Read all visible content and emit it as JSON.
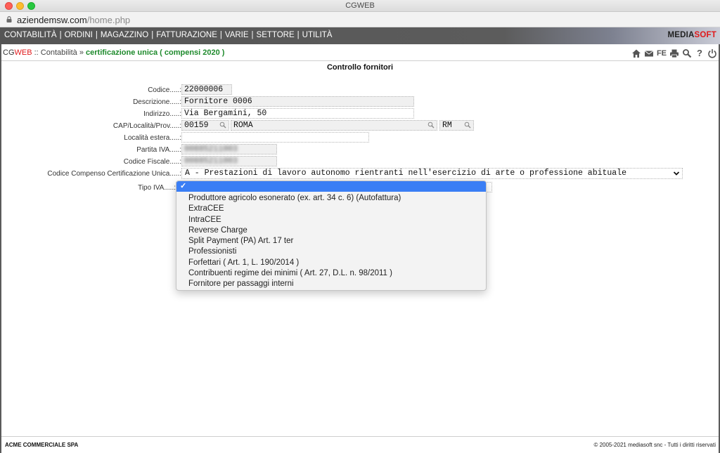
{
  "window": {
    "title": "CGWEB"
  },
  "address_bar": {
    "url_host": "aziendemsw.com",
    "url_path": "/home.php"
  },
  "nav": {
    "items": [
      "CONTABILITÀ",
      "ORDINI",
      "MAGAZZINO",
      "FATTURAZIONE",
      "VARIE",
      "SETTORE",
      "UTILITÀ"
    ],
    "separator": "|",
    "brand_a": "MEDIA",
    "brand_b": "SOFT",
    "brand_b_color": "#e0191b"
  },
  "breadcrumb": {
    "app_a": "CG",
    "app_b": "WEB",
    "sep1": " :: ",
    "section": "Contabilità",
    "sep2": " » ",
    "current": "certificazione unica ( compensi 2020 )"
  },
  "toolbar": {
    "icons": [
      "home-icon",
      "mail-icon",
      "fe-icon",
      "print-icon",
      "search-icon",
      "help-icon",
      "power-icon"
    ],
    "fe_label": "FE",
    "help_label": "?"
  },
  "page_title": "Controllo fornitori",
  "form": {
    "codice_label": "Codice.....:",
    "codice_value": "22000006",
    "descrizione_label": "Descrizione.....:",
    "descrizione_value": "Fornitore 0006",
    "indirizzo_label": "Indirizzo.....:",
    "indirizzo_value": "Via Bergamini, 50",
    "cap_label": "CAP/Località/Prov.....:",
    "cap_value": "00159",
    "localita_value": "ROMA",
    "prov_value": "RM",
    "localita_estera_label": "Località estera.....:",
    "localita_estera_value": "",
    "partita_iva_label": "Partita IVA.....:",
    "partita_iva_value": "00885211003",
    "codice_fiscale_label": "Codice Fiscale.....:",
    "codice_fiscale_value": "00885211003",
    "codice_compenso_label": "Codice Compenso Certificazione Unica.....:",
    "codice_compenso_value": "A - Prestazioni di lavoro autonomo rientranti nell'esercizio di arte o professione abituale",
    "tipo_iva_label": "Tipo IVA.....:"
  },
  "tipo_iva_dropdown": {
    "selected_value": "",
    "options": [
      "",
      "Produttore agricolo esonerato (ex. art. 34 c. 6) (Autofattura)",
      "ExtraCEE",
      "IntraCEE",
      "Reverse Charge",
      "Split Payment (PA) Art. 17 ter",
      "Professionisti",
      "Forfettari ( Art. 1, L. 190/2014 )",
      "Contribuenti regime dei minimi ( Art. 27, D.L. n. 98/2011 )",
      "Fornitore per passaggi interni"
    ],
    "check_glyph": "✓",
    "highlight_color": "#3a7ef5"
  },
  "footer": {
    "company": "ACME COMMERCIALE SPA",
    "copyright": "© 2005-2021 mediasoft snc - Tutti i diritti riservati"
  }
}
